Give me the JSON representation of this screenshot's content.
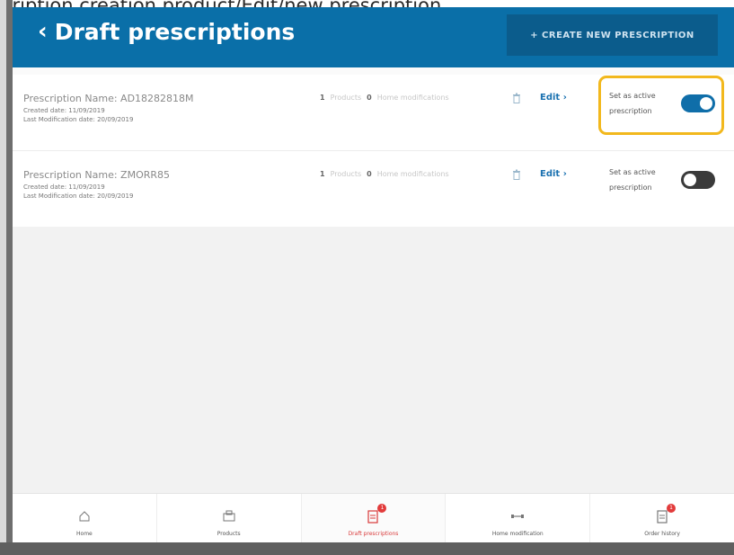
{
  "background_doc": {
    "top_line": "cription creation product/Edit/new prescription",
    "fragments": [
      "c",
      "e",
      "ti",
      "m",
      "y",
      "n",
      "e"
    ]
  },
  "header": {
    "back_label": "Draft prescriptions",
    "create_button": "+ CREATE NEW PRESCRIPTION",
    "color": "#0a6fa8"
  },
  "prescriptions": [
    {
      "name": "Prescription Name: AD18282818M",
      "created": "Created date: 11/09/2019",
      "modified": "Last Modification date: 20/09/2019",
      "products_count": "1",
      "products_label": "Products",
      "mods_count": "0",
      "mods_label": "Home modifications",
      "edit_label": "Edit",
      "active_label": "Set as active prescription",
      "active": true
    },
    {
      "name": "Prescription Name: ZMORR85",
      "created": "Created date: 11/09/2019",
      "modified": "Last Modification date: 20/09/2019",
      "products_count": "1",
      "products_label": "Products",
      "mods_count": "0",
      "mods_label": "Home modifications",
      "edit_label": "Edit",
      "active_label": "Set as active prescription",
      "active": false
    }
  ],
  "tabs": [
    {
      "label": "Home",
      "icon": "home-icon"
    },
    {
      "label": "Products",
      "icon": "products-icon"
    },
    {
      "label": "Draft prescriptions",
      "icon": "draft-icon",
      "badge": "1",
      "active": true
    },
    {
      "label": "Home modification",
      "icon": "home-modification-icon"
    },
    {
      "label": "Order history",
      "icon": "order-history-icon",
      "badge": "1"
    }
  ],
  "colors": {
    "accent": "#0a6fa8",
    "toggle_on": "#0f6ea9",
    "highlight": "#f2b81d",
    "badge": "#e23b3b"
  }
}
